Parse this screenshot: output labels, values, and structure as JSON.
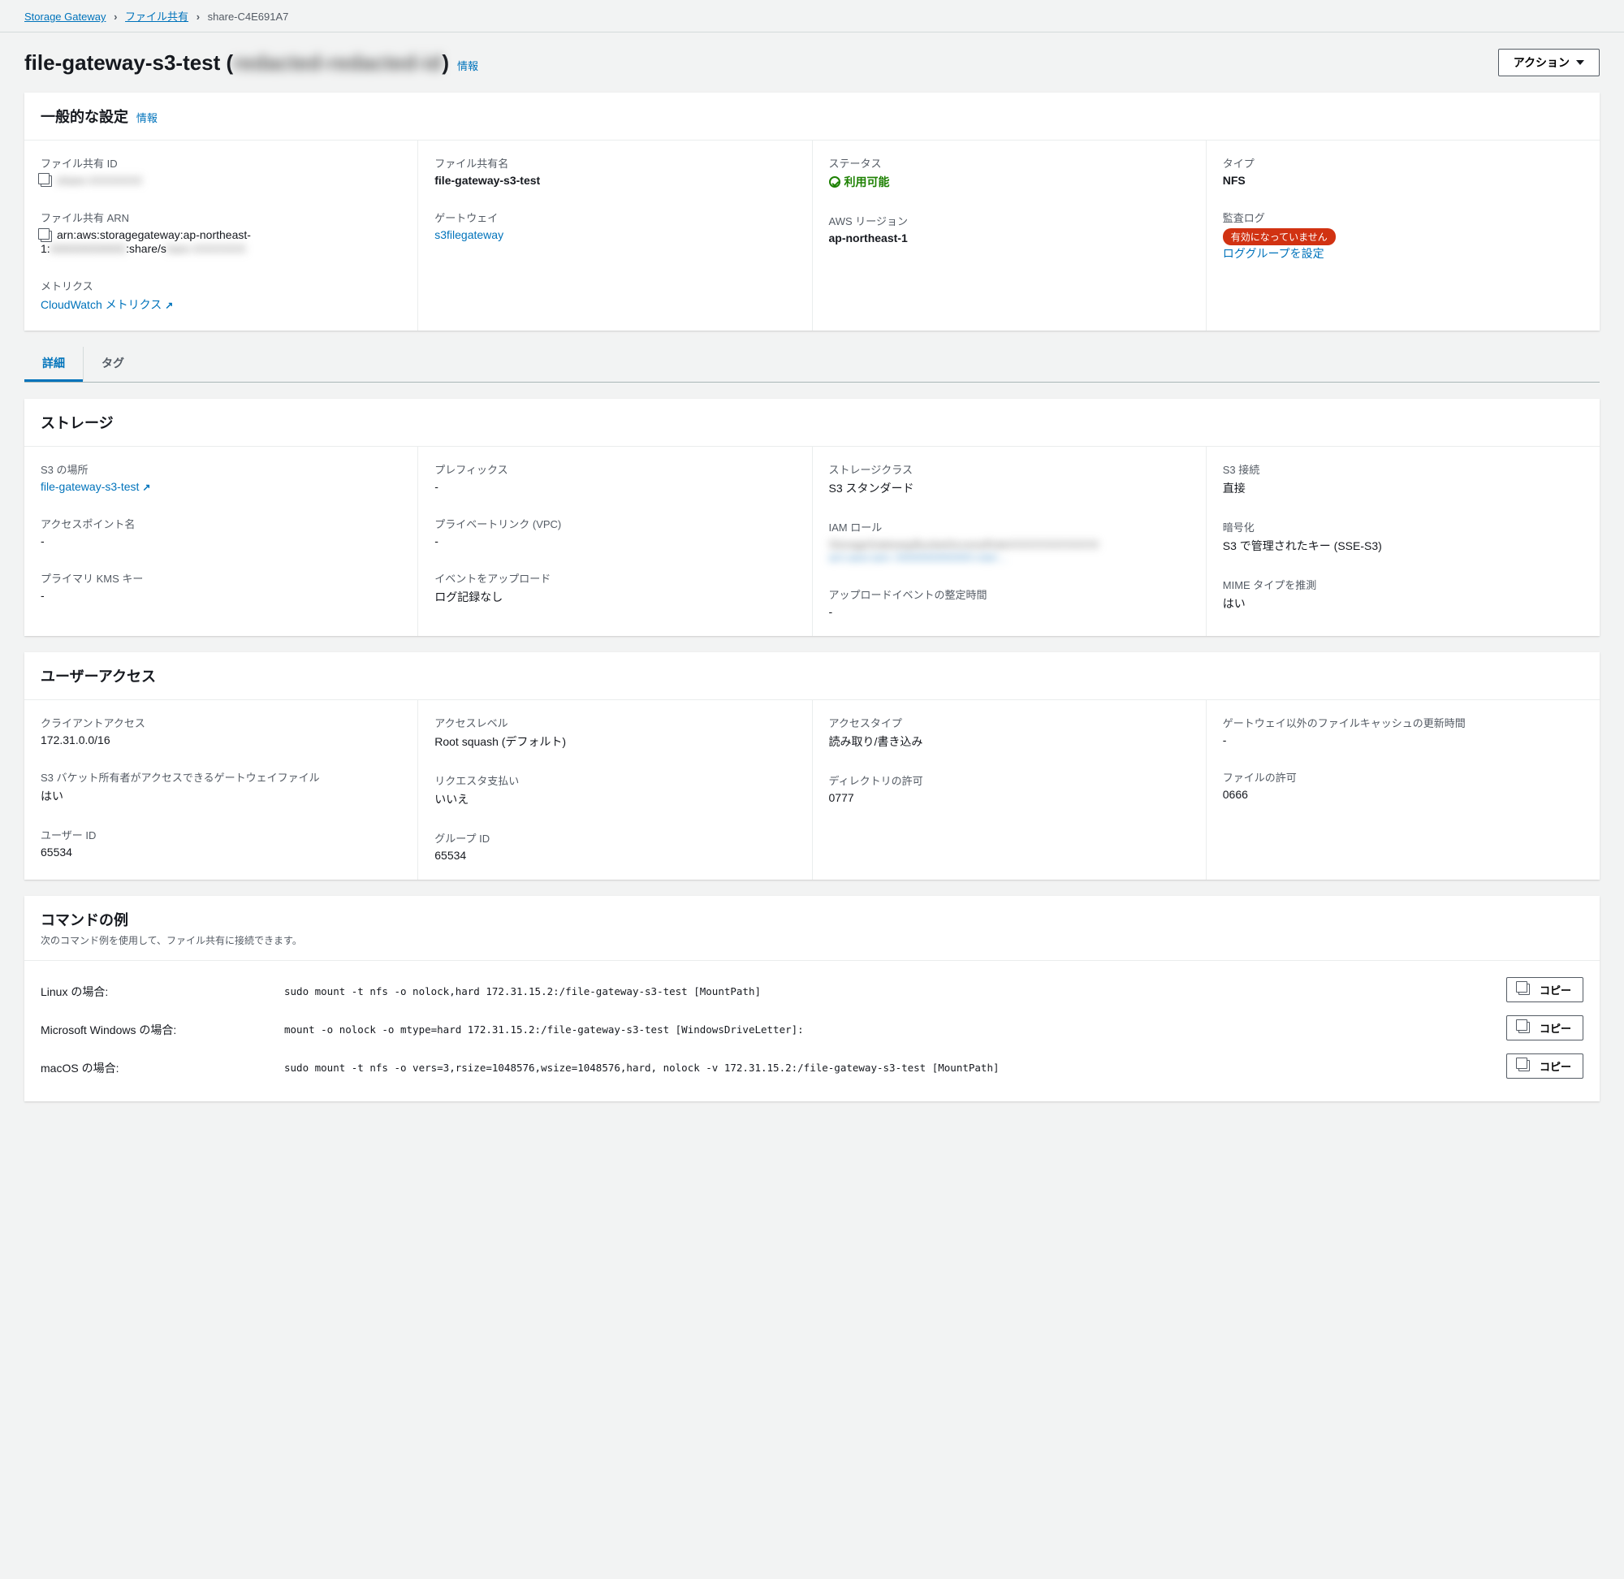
{
  "breadcrumb": {
    "root": "Storage Gateway",
    "mid": "ファイル共有",
    "current": "share-C4E691A7"
  },
  "header": {
    "title_prefix": "file-gateway-s3-test (",
    "title_blur": "redacted-redacted-id",
    "title_suffix": ")",
    "info": "情報",
    "action": "アクション"
  },
  "general": {
    "title": "一般的な設定",
    "info": "情報",
    "share_id_label": "ファイル共有 ID",
    "share_id_value": "share-XXXXXXX",
    "share_arn_label": "ファイル共有 ARN",
    "share_arn_line1": "arn:aws:storagegateway:ap-northeast-",
    "share_arn_line2a": "1:",
    "share_arn_line2_blur": "000000000000",
    "share_arn_line2b": ":share/s",
    "share_arn_line2_blur2": "hare-XXXXXXX",
    "metrics_label": "メトリクス",
    "metrics_link": "CloudWatch メトリクス",
    "share_name_label": "ファイル共有名",
    "share_name_value": "file-gateway-s3-test",
    "gateway_label": "ゲートウェイ",
    "gateway_link": "s3filegateway",
    "status_label": "ステータス",
    "status_value": "利用可能",
    "region_label": "AWS リージョン",
    "region_value": "ap-northeast-1",
    "type_label": "タイプ",
    "type_value": "NFS",
    "audit_label": "監査ログ",
    "audit_badge": "有効になっていません",
    "audit_link": "ロググループを設定"
  },
  "tabs": {
    "detail": "詳細",
    "tag": "タグ"
  },
  "storage": {
    "title": "ストレージ",
    "s3loc_label": "S3 の場所",
    "s3loc_link": "file-gateway-s3-test",
    "accesspoint_label": "アクセスポイント名",
    "accesspoint_value": "-",
    "kms_label": "プライマリ KMS キー",
    "kms_value": "-",
    "prefix_label": "プレフィックス",
    "prefix_value": "-",
    "privatelink_label": "プライベートリンク (VPC)",
    "privatelink_value": "-",
    "upload_label": "イベントをアップロード",
    "upload_value": "ログ記録なし",
    "storageclass_label": "ストレージクラス",
    "storageclass_value": "S3 スタンダード",
    "iam_label": "IAM ロール",
    "iam_blur1": "StorageGatewayBucketAccessRoleXXXXXXXXXXXX",
    "iam_blur2": "arn:aws:iam::000000000000:role/...",
    "settle_label": "アップロードイベントの整定時間",
    "settle_value": "-",
    "s3conn_label": "S3 接続",
    "s3conn_value": "直接",
    "enc_label": "暗号化",
    "enc_value": "S3 で管理されたキー (SSE-S3)",
    "mime_label": "MIME タイプを推測",
    "mime_value": "はい"
  },
  "access": {
    "title": "ユーザーアクセス",
    "client_label": "クライアントアクセス",
    "client_value": "172.31.0.0/16",
    "owner_label": "S3 バケット所有者がアクセスできるゲートウェイファイル",
    "owner_value": "はい",
    "uid_label": "ユーザー ID",
    "uid_value": "65534",
    "level_label": "アクセスレベル",
    "level_value": "Root squash (デフォルト)",
    "requester_label": "リクエスタ支払い",
    "requester_value": "いいえ",
    "gid_label": "グループ ID",
    "gid_value": "65534",
    "type_label": "アクセスタイプ",
    "type_value": "読み取り/書き込み",
    "dirperm_label": "ディレクトリの許可",
    "dirperm_value": "0777",
    "refresh_label": "ゲートウェイ以外のファイルキャッシュの更新時間",
    "refresh_value": "-",
    "fileperm_label": "ファイルの許可",
    "fileperm_value": "0666"
  },
  "commands": {
    "title": "コマンドの例",
    "sub": "次のコマンド例を使用して、ファイル共有に接続できます。",
    "copy": "コピー",
    "rows": [
      {
        "label": "Linux の場合:",
        "cmd": "sudo mount -t nfs -o nolock,hard 172.31.15.2:/file-gateway-s3-test [MountPath]"
      },
      {
        "label": "Microsoft Windows の場合:",
        "cmd": "mount -o nolock -o mtype=hard 172.31.15.2:/file-gateway-s3-test [WindowsDriveLetter]:"
      },
      {
        "label": "macOS の場合:",
        "cmd": "sudo mount -t nfs -o vers=3,rsize=1048576,wsize=1048576,hard, nolock -v 172.31.15.2:/file-gateway-s3-test [MountPath]"
      }
    ]
  }
}
